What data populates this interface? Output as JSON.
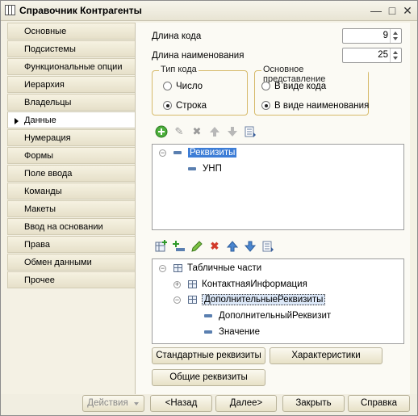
{
  "window": {
    "title": "Справочник Контрагенты"
  },
  "sidebar": {
    "items": [
      {
        "label": "Основные"
      },
      {
        "label": "Подсистемы"
      },
      {
        "label": "Функциональные опции"
      },
      {
        "label": "Иерархия"
      },
      {
        "label": "Владельцы"
      },
      {
        "label": "Данные",
        "active": true
      },
      {
        "label": "Нумерация"
      },
      {
        "label": "Формы"
      },
      {
        "label": "Поле ввода"
      },
      {
        "label": "Команды"
      },
      {
        "label": "Макеты"
      },
      {
        "label": "Ввод на основании"
      },
      {
        "label": "Права"
      },
      {
        "label": "Обмен данными"
      },
      {
        "label": "Прочее"
      }
    ]
  },
  "fields": {
    "code_length_label": "Длина кода",
    "code_length_value": "9",
    "name_length_label": "Длина наименования",
    "name_length_value": "25"
  },
  "code_type": {
    "title": "Тип кода",
    "options": [
      "Число",
      "Строка"
    ],
    "selected": "Строка"
  },
  "main_repr": {
    "title": "Основное представление",
    "options": [
      "В виде кода",
      "В виде наименования"
    ],
    "selected": "В виде наименования"
  },
  "attributes_tree": {
    "root": "Реквизиты",
    "children": [
      "УНП"
    ]
  },
  "tabular_tree": {
    "root": "Табличные части",
    "items": [
      "КонтактнаяИнформация",
      "ДополнительныеРеквизиты"
    ],
    "subitems": [
      "ДополнительныйРеквизит",
      "Значение"
    ]
  },
  "panel_buttons": {
    "standard": "Стандартные реквизиты",
    "characteristics": "Характеристики",
    "common": "Общие реквизиты"
  },
  "footer": {
    "actions": "Действия",
    "back": "<Назад",
    "next": "Далее>",
    "close": "Закрыть",
    "help": "Справка"
  },
  "colors": {
    "selection": "#3d7dd6",
    "group_border": "#d6ba6a"
  }
}
